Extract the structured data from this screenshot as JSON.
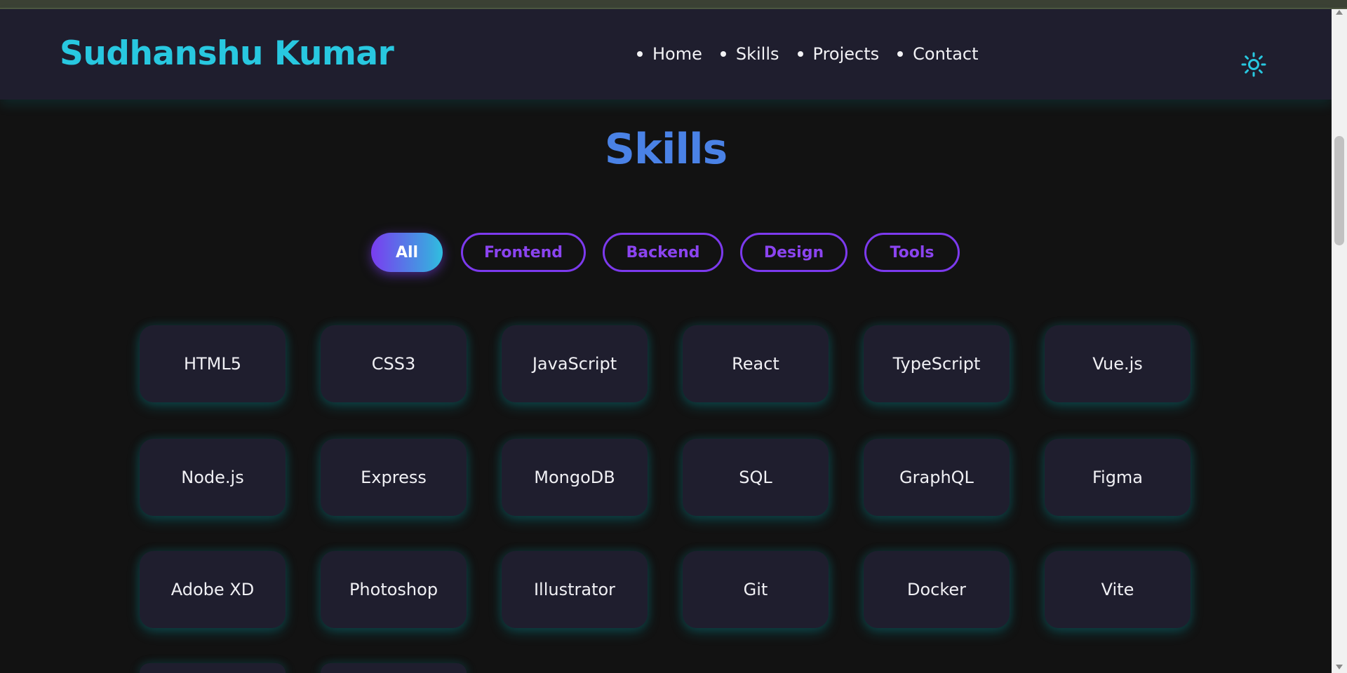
{
  "brand": "Sudhanshu Kumar",
  "nav": [
    "Home",
    "Skills",
    "Projects",
    "Contact"
  ],
  "section_title": "Skills",
  "filters": [
    "All",
    "Frontend",
    "Backend",
    "Design",
    "Tools"
  ],
  "active_filter": "All",
  "skills": [
    "HTML5",
    "CSS3",
    "JavaScript",
    "React",
    "TypeScript",
    "Vue.js",
    "Node.js",
    "Express",
    "MongoDB",
    "SQL",
    "GraphQL",
    "Figma",
    "Adobe XD",
    "Photoshop",
    "Illustrator",
    "Git",
    "Docker",
    "Vite"
  ],
  "colors": {
    "brand": "#28c8e0",
    "title": "#4a82e6",
    "filter_border": "#7c3aed",
    "card_bg": "#1f1e2e",
    "page_bg": "#121212"
  },
  "icons": {
    "theme_toggle": "sun-icon"
  }
}
